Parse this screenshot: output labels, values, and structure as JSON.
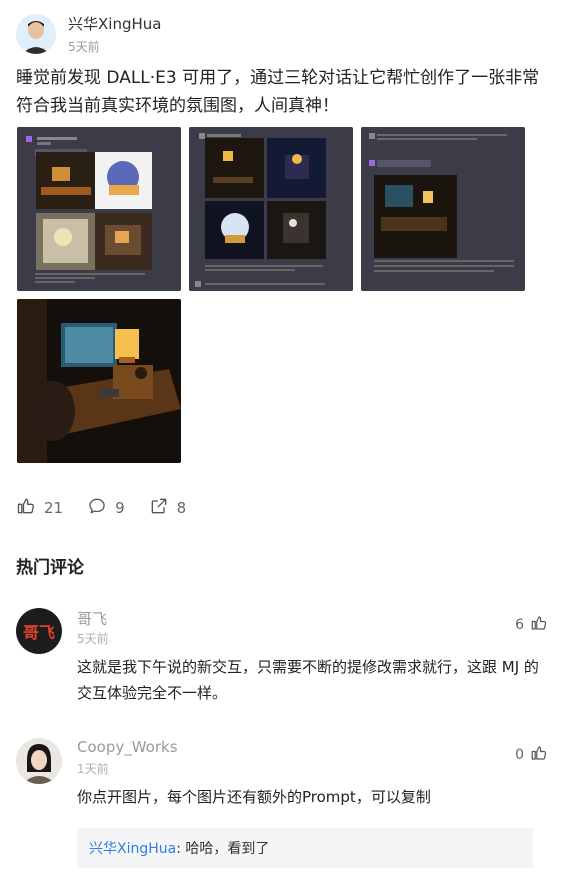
{
  "post": {
    "author": "兴华XingHua",
    "time": "5天前",
    "content": "睡觉前发现 DALL·E3 可用了，通过三轮对话让它帮忙创作了一张非常符合我当前真实环境的氛围图，人间真神！"
  },
  "actions": {
    "likes": "21",
    "comments": "9",
    "shares": "8"
  },
  "hot_comments": {
    "title": "热门评论",
    "items": [
      {
        "avatar_text": "哥飞",
        "name": "哥飞",
        "time": "5天前",
        "likes": "6",
        "text": "这就是我下午说的新交互，只需要不断的提修改需求就行，这跟 MJ 的交互体验完全不一样。"
      },
      {
        "name": "Coopy_Works",
        "time": "1天前",
        "likes": "0",
        "text": "你点开图片，每个图片还有额外的Prompt，可以复制",
        "reply": {
          "user": "兴华XingHua",
          "text": ": 哈哈，看到了"
        }
      }
    ]
  },
  "colors": {
    "accent": "#2f7ee0",
    "avatar_red": "#e2412d"
  }
}
